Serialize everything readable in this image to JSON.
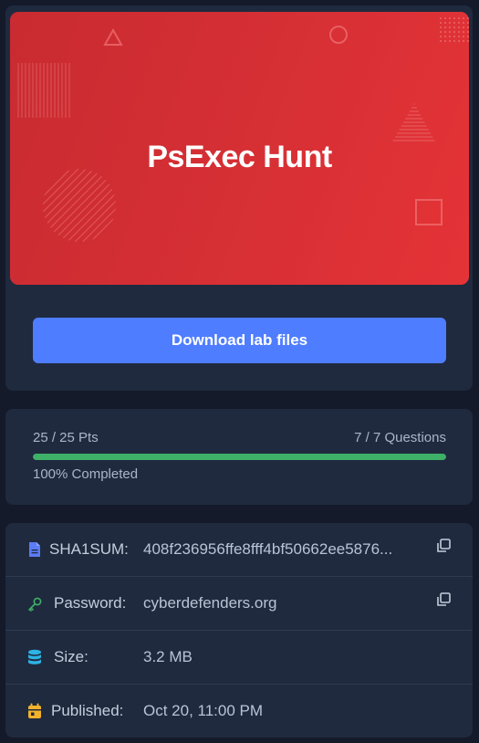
{
  "lab": {
    "title": "PsExec Hunt",
    "download_label": "Download lab files"
  },
  "progress": {
    "points": "25 / 25 Pts",
    "questions": "7 / 7 Questions",
    "completed_label": "100% Completed",
    "percent": 100
  },
  "info": {
    "sha1": {
      "label": "SHA1SUM:",
      "value": "408f236956ffe8fff4bf50662ee5876...",
      "icon": "file-icon"
    },
    "password": {
      "label": "Password:",
      "value": "cyberdefenders.org",
      "icon": "key-icon"
    },
    "size": {
      "label": "Size:",
      "value": "3.2 MB",
      "icon": "database-icon"
    },
    "published": {
      "label": "Published:",
      "value": "Oct 20, 11:00 PM",
      "icon": "calendar-icon"
    }
  },
  "colors": {
    "accent_button": "#4f7dff",
    "progress_green": "#3fb068",
    "banner_red": "#d83035",
    "file_icon": "#5b7cf5",
    "key_icon": "#3fb068",
    "database_icon": "#2eb3e6",
    "calendar_icon": "#f2b22a"
  }
}
